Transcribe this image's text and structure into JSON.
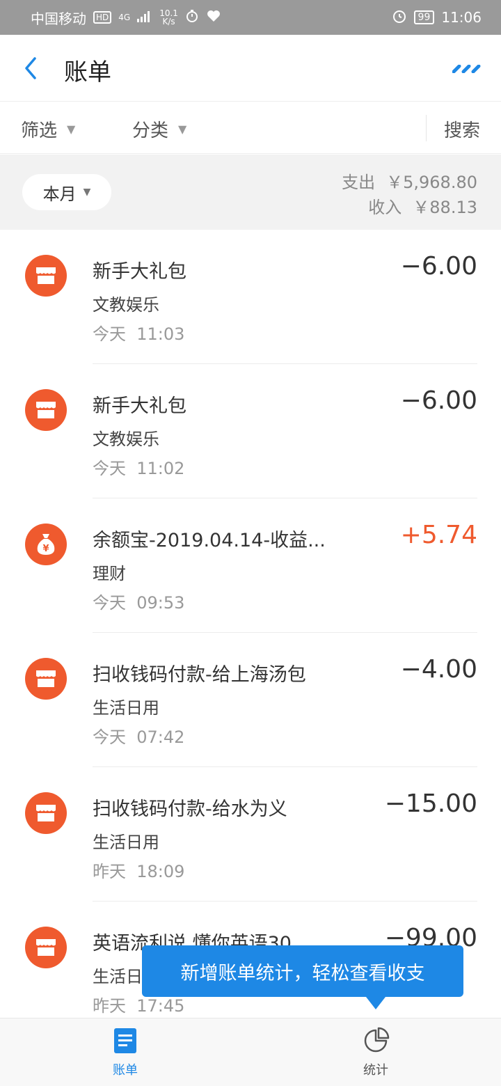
{
  "status_bar": {
    "carrier": "中国移动",
    "hd": "HD",
    "signal": "4G",
    "speed_top": "10.1",
    "speed_bottom": "K/s",
    "battery": "99",
    "time": "11:06"
  },
  "header": {
    "title": "账单"
  },
  "filters": {
    "filter_label": "筛选",
    "category_label": "分类",
    "search_label": "搜索"
  },
  "summary": {
    "month_label": "本月",
    "expense_label": "支出",
    "expense_value": "￥5,968.80",
    "income_label": "收入",
    "income_value": "￥88.13"
  },
  "transactions": [
    {
      "name": "新手大礼包",
      "category": "文教娱乐",
      "day": "今天",
      "time": "11:03",
      "amount": "−6.00",
      "icon": "store-icon",
      "type": "expense"
    },
    {
      "name": "新手大礼包",
      "category": "文教娱乐",
      "day": "今天",
      "time": "11:02",
      "amount": "−6.00",
      "icon": "store-icon",
      "type": "expense"
    },
    {
      "name": "余额宝-2019.04.14-收益...",
      "category": "理财",
      "day": "今天",
      "time": "09:53",
      "amount": "+5.74",
      "icon": "money-bag-icon",
      "type": "income"
    },
    {
      "name": "扫收钱码付款-给上海汤包",
      "category": "生活日用",
      "day": "今天",
      "time": "07:42",
      "amount": "−4.00",
      "icon": "store-icon",
      "type": "expense"
    },
    {
      "name": "扫收钱码付款-给水为义",
      "category": "生活日用",
      "day": "昨天",
      "time": "18:09",
      "amount": "−15.00",
      "icon": "store-icon",
      "type": "expense"
    },
    {
      "name": "英语流利说 懂你英语30",
      "category": "生活日用",
      "day": "昨天",
      "time": "17:45",
      "amount": "−99.00",
      "icon": "store-icon",
      "type": "expense"
    }
  ],
  "tooltip": {
    "text": "新增账单统计，轻松查看收支"
  },
  "bottom_nav": {
    "bill_label": "账单",
    "stats_label": "统计"
  },
  "colors": {
    "accent": "#1e88e5",
    "income": "#ef5a2e",
    "icon_bg": "#ef5a2e"
  }
}
